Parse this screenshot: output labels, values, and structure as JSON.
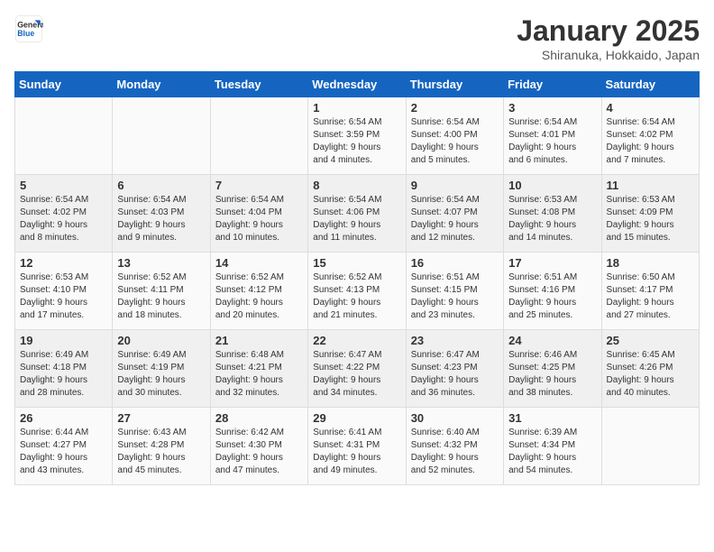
{
  "header": {
    "logo_line1": "General",
    "logo_line2": "Blue",
    "month_title": "January 2025",
    "location": "Shiranuka, Hokkaido, Japan"
  },
  "days_of_week": [
    "Sunday",
    "Monday",
    "Tuesday",
    "Wednesday",
    "Thursday",
    "Friday",
    "Saturday"
  ],
  "weeks": [
    [
      {
        "day": "",
        "info": ""
      },
      {
        "day": "",
        "info": ""
      },
      {
        "day": "",
        "info": ""
      },
      {
        "day": "1",
        "info": "Sunrise: 6:54 AM\nSunset: 3:59 PM\nDaylight: 9 hours\nand 4 minutes."
      },
      {
        "day": "2",
        "info": "Sunrise: 6:54 AM\nSunset: 4:00 PM\nDaylight: 9 hours\nand 5 minutes."
      },
      {
        "day": "3",
        "info": "Sunrise: 6:54 AM\nSunset: 4:01 PM\nDaylight: 9 hours\nand 6 minutes."
      },
      {
        "day": "4",
        "info": "Sunrise: 6:54 AM\nSunset: 4:02 PM\nDaylight: 9 hours\nand 7 minutes."
      }
    ],
    [
      {
        "day": "5",
        "info": "Sunrise: 6:54 AM\nSunset: 4:02 PM\nDaylight: 9 hours\nand 8 minutes."
      },
      {
        "day": "6",
        "info": "Sunrise: 6:54 AM\nSunset: 4:03 PM\nDaylight: 9 hours\nand 9 minutes."
      },
      {
        "day": "7",
        "info": "Sunrise: 6:54 AM\nSunset: 4:04 PM\nDaylight: 9 hours\nand 10 minutes."
      },
      {
        "day": "8",
        "info": "Sunrise: 6:54 AM\nSunset: 4:06 PM\nDaylight: 9 hours\nand 11 minutes."
      },
      {
        "day": "9",
        "info": "Sunrise: 6:54 AM\nSunset: 4:07 PM\nDaylight: 9 hours\nand 12 minutes."
      },
      {
        "day": "10",
        "info": "Sunrise: 6:53 AM\nSunset: 4:08 PM\nDaylight: 9 hours\nand 14 minutes."
      },
      {
        "day": "11",
        "info": "Sunrise: 6:53 AM\nSunset: 4:09 PM\nDaylight: 9 hours\nand 15 minutes."
      }
    ],
    [
      {
        "day": "12",
        "info": "Sunrise: 6:53 AM\nSunset: 4:10 PM\nDaylight: 9 hours\nand 17 minutes."
      },
      {
        "day": "13",
        "info": "Sunrise: 6:52 AM\nSunset: 4:11 PM\nDaylight: 9 hours\nand 18 minutes."
      },
      {
        "day": "14",
        "info": "Sunrise: 6:52 AM\nSunset: 4:12 PM\nDaylight: 9 hours\nand 20 minutes."
      },
      {
        "day": "15",
        "info": "Sunrise: 6:52 AM\nSunset: 4:13 PM\nDaylight: 9 hours\nand 21 minutes."
      },
      {
        "day": "16",
        "info": "Sunrise: 6:51 AM\nSunset: 4:15 PM\nDaylight: 9 hours\nand 23 minutes."
      },
      {
        "day": "17",
        "info": "Sunrise: 6:51 AM\nSunset: 4:16 PM\nDaylight: 9 hours\nand 25 minutes."
      },
      {
        "day": "18",
        "info": "Sunrise: 6:50 AM\nSunset: 4:17 PM\nDaylight: 9 hours\nand 27 minutes."
      }
    ],
    [
      {
        "day": "19",
        "info": "Sunrise: 6:49 AM\nSunset: 4:18 PM\nDaylight: 9 hours\nand 28 minutes."
      },
      {
        "day": "20",
        "info": "Sunrise: 6:49 AM\nSunset: 4:19 PM\nDaylight: 9 hours\nand 30 minutes."
      },
      {
        "day": "21",
        "info": "Sunrise: 6:48 AM\nSunset: 4:21 PM\nDaylight: 9 hours\nand 32 minutes."
      },
      {
        "day": "22",
        "info": "Sunrise: 6:47 AM\nSunset: 4:22 PM\nDaylight: 9 hours\nand 34 minutes."
      },
      {
        "day": "23",
        "info": "Sunrise: 6:47 AM\nSunset: 4:23 PM\nDaylight: 9 hours\nand 36 minutes."
      },
      {
        "day": "24",
        "info": "Sunrise: 6:46 AM\nSunset: 4:25 PM\nDaylight: 9 hours\nand 38 minutes."
      },
      {
        "day": "25",
        "info": "Sunrise: 6:45 AM\nSunset: 4:26 PM\nDaylight: 9 hours\nand 40 minutes."
      }
    ],
    [
      {
        "day": "26",
        "info": "Sunrise: 6:44 AM\nSunset: 4:27 PM\nDaylight: 9 hours\nand 43 minutes."
      },
      {
        "day": "27",
        "info": "Sunrise: 6:43 AM\nSunset: 4:28 PM\nDaylight: 9 hours\nand 45 minutes."
      },
      {
        "day": "28",
        "info": "Sunrise: 6:42 AM\nSunset: 4:30 PM\nDaylight: 9 hours\nand 47 minutes."
      },
      {
        "day": "29",
        "info": "Sunrise: 6:41 AM\nSunset: 4:31 PM\nDaylight: 9 hours\nand 49 minutes."
      },
      {
        "day": "30",
        "info": "Sunrise: 6:40 AM\nSunset: 4:32 PM\nDaylight: 9 hours\nand 52 minutes."
      },
      {
        "day": "31",
        "info": "Sunrise: 6:39 AM\nSunset: 4:34 PM\nDaylight: 9 hours\nand 54 minutes."
      },
      {
        "day": "",
        "info": ""
      }
    ]
  ]
}
